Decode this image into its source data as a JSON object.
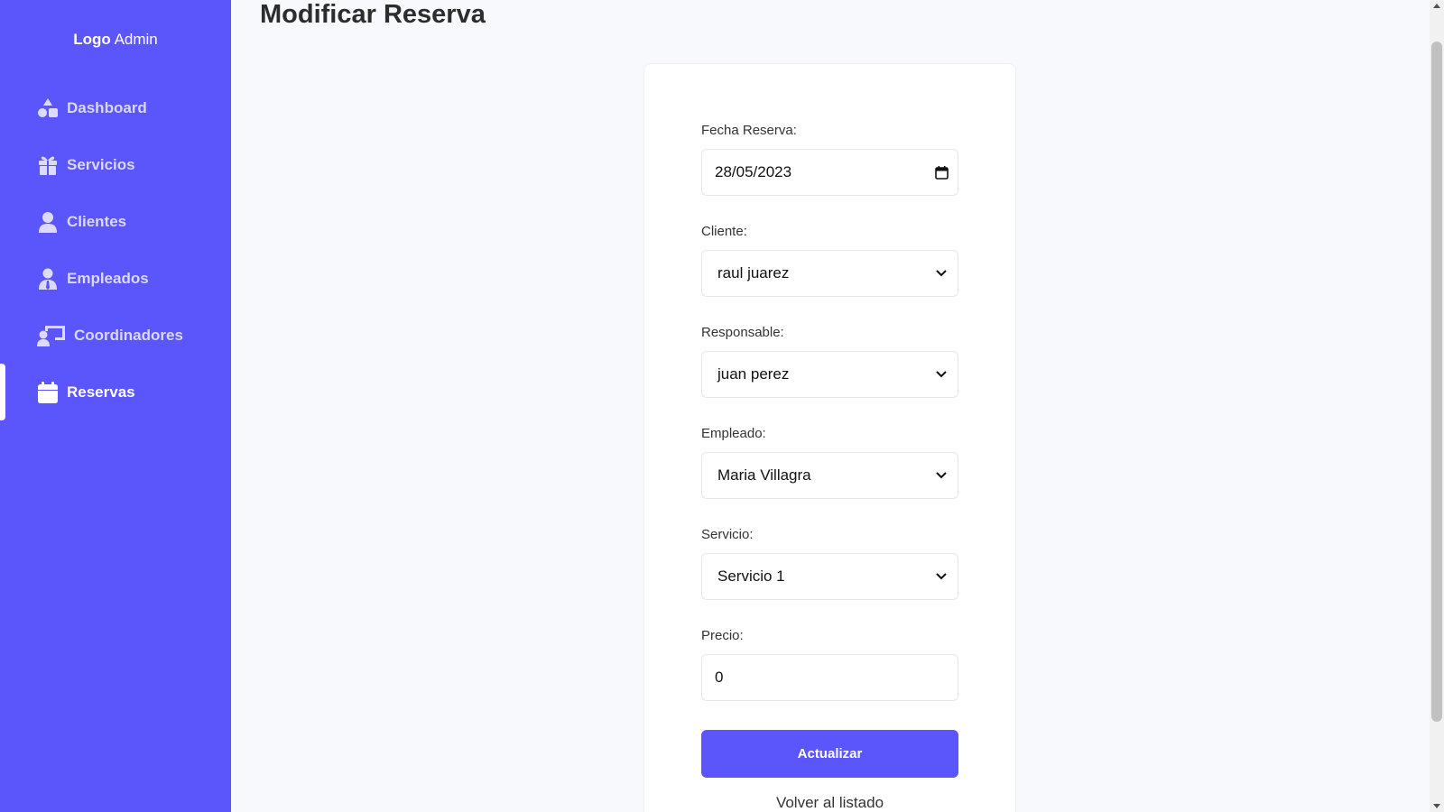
{
  "sidebar": {
    "logo_strong": "Logo",
    "logo_rest": " Admin",
    "items": [
      {
        "label": "Dashboard",
        "icon": "shapes-icon"
      },
      {
        "label": "Servicios",
        "icon": "gift-icon"
      },
      {
        "label": "Clientes",
        "icon": "user-icon"
      },
      {
        "label": "Empleados",
        "icon": "user-tie-icon"
      },
      {
        "label": "Coordinadores",
        "icon": "chalkboard-user-icon"
      },
      {
        "label": "Reservas",
        "icon": "calendar-icon",
        "active": true
      }
    ]
  },
  "page": {
    "title": "Modificar Reserva"
  },
  "form": {
    "fecha_label": "Fecha Reserva:",
    "fecha_value": "28/05/2023",
    "cliente_label": "Cliente:",
    "cliente_value": "raul juarez",
    "responsable_label": "Responsable:",
    "responsable_value": "juan perez",
    "empleado_label": "Empleado:",
    "empleado_value": "Maria Villagra",
    "servicio_label": "Servicio:",
    "servicio_value": "Servicio 1",
    "precio_label": "Precio:",
    "precio_value": "0",
    "submit_label": "Actualizar",
    "back_label": "Volver al listado"
  },
  "colors": {
    "accent": "#5b55fc",
    "background": "#f8f9fd",
    "card": "#ffffff"
  }
}
